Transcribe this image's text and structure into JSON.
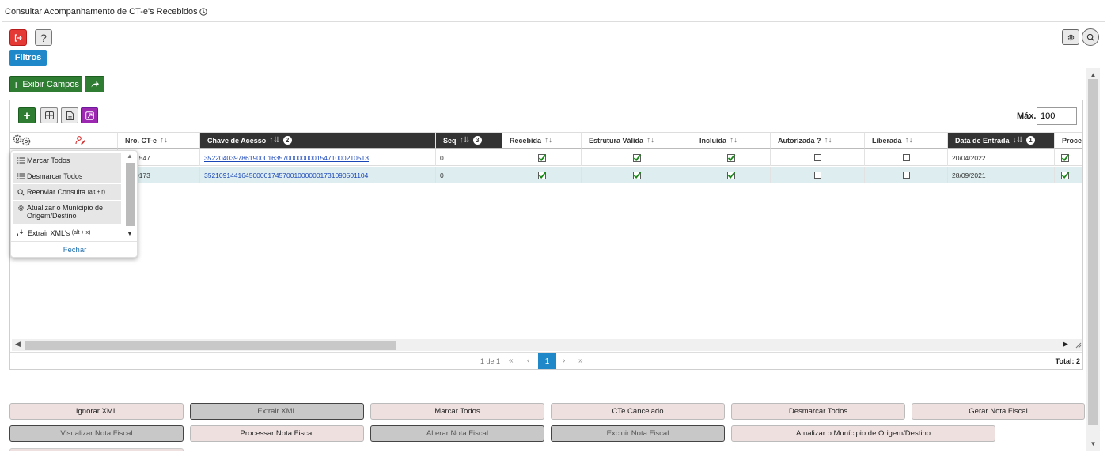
{
  "page": {
    "title": "Consultar Acompanhamento de CT-e's Recebidos",
    "filtros_label": "Filtros",
    "exibir_campos_label": "Exibir Campos",
    "help_label": "?"
  },
  "grid": {
    "max_label": "Máx.",
    "max_value": "100",
    "columns": [
      {
        "label": "Nro. CT-e",
        "sort": "↑↓",
        "badge": ""
      },
      {
        "label": "Chave de Acesso",
        "sort": "↑⇊",
        "badge": "2"
      },
      {
        "label": "Seq",
        "sort": "↑⇊",
        "badge": "3"
      },
      {
        "label": "Recebida",
        "sort": "↑↓",
        "badge": ""
      },
      {
        "label": "Estrutura Válida",
        "sort": "↑↓",
        "badge": ""
      },
      {
        "label": "Incluída",
        "sort": "↑↓",
        "badge": ""
      },
      {
        "label": "Autorizada ?",
        "sort": "↑↓",
        "badge": ""
      },
      {
        "label": "Liberada",
        "sort": "↑↓",
        "badge": ""
      },
      {
        "label": "Data de Entrada",
        "sort": "↓⇊",
        "badge": "1"
      },
      {
        "label": "Process",
        "sort": "",
        "badge": ""
      }
    ],
    "rows": [
      {
        "nro": "1547",
        "chave": "35220403978619000163570000000015471000210513",
        "seq": "0",
        "recebida": true,
        "estrutura": true,
        "incluida": true,
        "autorizada": false,
        "liberada": false,
        "data": "20/04/2022",
        "process": true
      },
      {
        "nro": "0173",
        "chave": "35210914416450000174570010000001731090501104",
        "seq": "0",
        "recebida": true,
        "estrutura": true,
        "incluida": true,
        "autorizada": false,
        "liberada": false,
        "data": "28/09/2021",
        "process": true
      }
    ],
    "pager": {
      "text": "1 de 1",
      "first": "«",
      "prev": "‹",
      "page": "1",
      "next": "›",
      "last": "»",
      "total": "Total: 2"
    }
  },
  "popup_menu": {
    "items": [
      {
        "label": "Marcar Todos",
        "shortcut": ""
      },
      {
        "label": "Desmarcar Todos",
        "shortcut": ""
      },
      {
        "label": "Reenviar Consulta",
        "shortcut": "(alt + r)"
      },
      {
        "label": "Atualizar o Munícipio de Origem/Destino",
        "shortcut": ""
      },
      {
        "label": "Extrair XML's",
        "shortcut": "(alt + x)"
      }
    ],
    "close_label": "Fechar"
  },
  "actions": [
    {
      "label": "Ignorar XML",
      "style": "pink"
    },
    {
      "label": "Extrair XML",
      "style": "gray"
    },
    {
      "label": "Marcar Todos",
      "style": "pink"
    },
    {
      "label": "CTe Cancelado",
      "style": "pink"
    },
    {
      "label": "Desmarcar Todos",
      "style": "pink"
    },
    {
      "label": "Gerar Nota Fiscal",
      "style": "pink"
    },
    {
      "label": "Visualizar Nota Fiscal",
      "style": "gray"
    },
    {
      "label": "Processar Nota Fiscal",
      "style": "pink"
    },
    {
      "label": "Alterar Nota Fiscal",
      "style": "gray"
    },
    {
      "label": "Excluir Nota Fiscal",
      "style": "gray"
    },
    {
      "label": "Atualizar o Munícipio de Origem/Destino",
      "style": "pink"
    }
  ],
  "icons": {
    "exit": "exit-icon",
    "help": "help-icon",
    "settings": "gear-icon",
    "search": "search-icon",
    "clock": "clock-icon",
    "add": "plus-icon",
    "share": "share-icon",
    "grid": "grid-icon",
    "pdf": "pdf-icon",
    "expand": "expand-icon",
    "user_edit": "user-edit-icon",
    "check": "check-icon"
  },
  "colors": {
    "primary_blue": "#1e88c8",
    "green": "#2e7d32",
    "red": "#e53935",
    "purple": "#9c27b0",
    "dark_header": "#333333",
    "link": "#1a46b8",
    "row_alt": "#deeef0",
    "action_pink": "#efe0e0"
  }
}
